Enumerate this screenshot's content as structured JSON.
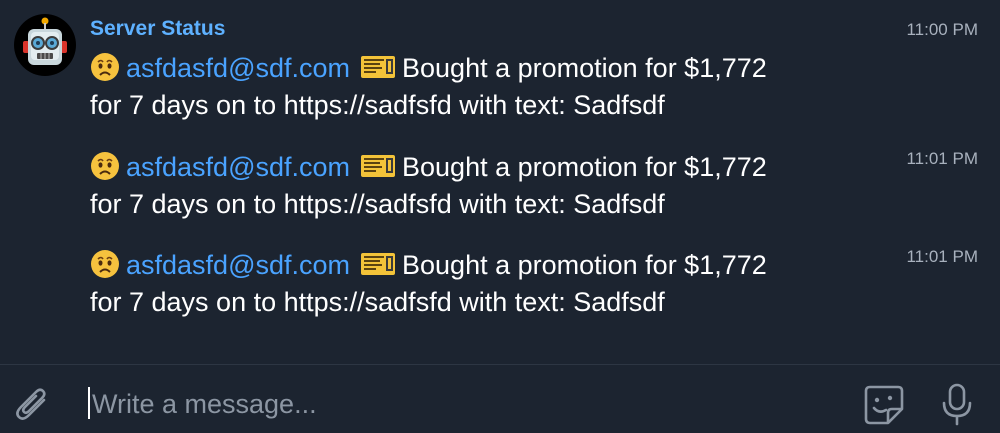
{
  "chat": {
    "sender": "Server Status",
    "messages": [
      {
        "email": "asfdasfd@sdf.com",
        "text1": "Bought a promotion for $1,772",
        "text2": "for 7 days on  to https://sadfsfd with text: Sadfsdf",
        "time": "11:00 PM",
        "icons": [
          "face-emoji-icon",
          "ticket-emoji-icon"
        ]
      },
      {
        "email": "asfdasfd@sdf.com",
        "text1": "Bought a promotion for $1,772",
        "text2": "for 7 days on  to https://sadfsfd with text: Sadfsdf",
        "time": "11:01 PM",
        "icons": [
          "face-emoji-icon",
          "ticket-emoji-icon"
        ]
      },
      {
        "email": "asfdasfd@sdf.com",
        "text1": "Bought a promotion for $1,772",
        "text2": "for 7 days on  to https://sadfsfd with text: Sadfsdf",
        "time": "11:01 PM",
        "icons": [
          "face-emoji-icon",
          "ticket-emoji-icon"
        ]
      }
    ]
  },
  "composer": {
    "placeholder": "Write a message...",
    "icons": [
      "paperclip-icon",
      "sticker-icon",
      "microphone-icon"
    ]
  },
  "colors": {
    "background": "#1c2430",
    "sender_name": "#5eb1ff",
    "link": "#4aa3ff",
    "timestamp": "#a8b1bd"
  }
}
